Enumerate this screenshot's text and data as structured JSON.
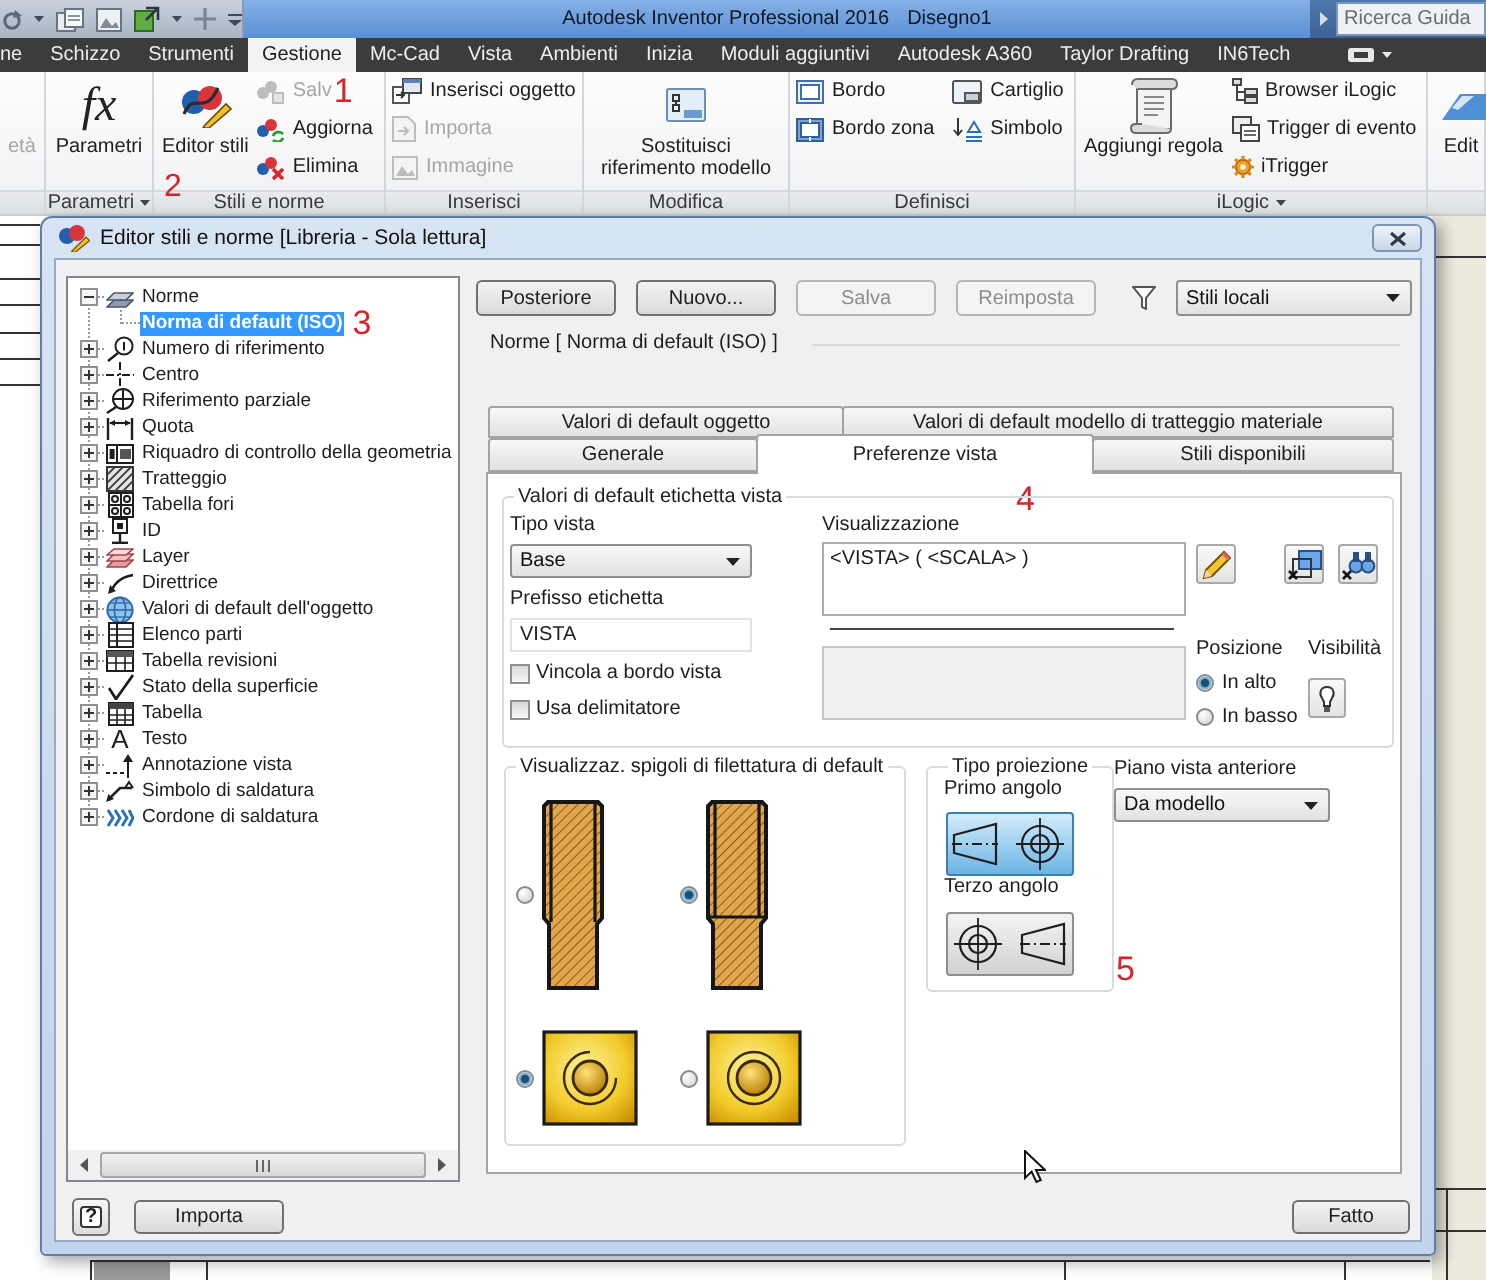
{
  "title_bar": {
    "title": "Autodesk Inventor Professional 2016",
    "document": "Disegno1",
    "search": {
      "placeholder": "Ricerca Guida"
    }
  },
  "ribbon_tabs": [
    {
      "label": "ne",
      "selected": false
    },
    {
      "label": "Schizzo",
      "selected": false
    },
    {
      "label": "Strumenti",
      "selected": false
    },
    {
      "label": "Gestione",
      "selected": true
    },
    {
      "label": "Mc-Cad",
      "selected": false
    },
    {
      "label": "Vista",
      "selected": false
    },
    {
      "label": "Ambienti",
      "selected": false
    },
    {
      "label": "Inizia",
      "selected": false
    },
    {
      "label": "Moduli aggiuntivi",
      "selected": false
    },
    {
      "label": "Autodesk A360",
      "selected": false
    },
    {
      "label": "Taylor Drafting",
      "selected": false
    },
    {
      "label": "IN6Tech",
      "selected": false
    }
  ],
  "ribbon_panels": [
    {
      "buttons": [
        {
          "kind": "large",
          "label": "età",
          "disabled": true
        }
      ]
    },
    {
      "title": "Parametri",
      "menu": true,
      "buttons": [
        {
          "kind": "large",
          "label": "Parametri",
          "glyph": "fx",
          "disabled": false
        }
      ]
    },
    {
      "title": "Stili e norme",
      "menu": false,
      "marker": "2",
      "buttons": [
        {
          "kind": "large",
          "label": "Editor stili",
          "disabled": false
        },
        {
          "kind": "small",
          "label": "Salv",
          "disabled": true,
          "marker": "1"
        },
        {
          "kind": "small",
          "label": "Aggiorna",
          "disabled": false
        },
        {
          "kind": "small",
          "label": "Elimina",
          "disabled": false
        }
      ]
    },
    {
      "title": "Inserisci",
      "menu": false,
      "buttons": [
        {
          "kind": "small",
          "label": "Inserisci oggetto",
          "disabled": false
        },
        {
          "kind": "small",
          "label": "Importa",
          "disabled": true
        },
        {
          "kind": "small",
          "label": "Immagine",
          "disabled": true
        }
      ]
    },
    {
      "title": "Modifica",
      "menu": false,
      "buttons": [
        {
          "kind": "large",
          "label": "Sostituisci riferimento modello",
          "disabled": false
        }
      ]
    },
    {
      "title": "Definisci",
      "menu": false,
      "buttons": [
        {
          "kind": "small",
          "label": "Bordo",
          "disabled": false
        },
        {
          "kind": "small",
          "label": "Bordo zona",
          "disabled": false
        },
        {
          "kind": "small",
          "label": "Cartiglio",
          "disabled": false
        },
        {
          "kind": "small",
          "label": "Simbolo",
          "disabled": false
        }
      ]
    },
    {
      "title": "iLogic",
      "menu": true,
      "buttons": [
        {
          "kind": "large",
          "label": "Aggiungi regola",
          "disabled": false
        },
        {
          "kind": "small",
          "label": "Browser iLogic",
          "disabled": false
        },
        {
          "kind": "small",
          "label": "Trigger di evento",
          "disabled": false
        },
        {
          "kind": "small",
          "label": "iTrigger",
          "disabled": false
        }
      ]
    },
    {
      "buttons": [
        {
          "kind": "large",
          "label": "Edit",
          "disabled": false
        }
      ]
    }
  ],
  "dialog": {
    "title": "Editor stili e norme [Libreria - Sola lettura]",
    "tree": [
      {
        "label": "Norme",
        "expanded": true,
        "selected": false,
        "children": [
          {
            "label": "Norma di default (ISO)",
            "selected": true,
            "marker": "3"
          }
        ]
      },
      {
        "label": "Numero di riferimento",
        "expanded": false,
        "selected": false
      },
      {
        "label": "Centro",
        "expanded": false,
        "selected": false
      },
      {
        "label": "Riferimento parziale",
        "expanded": false,
        "selected": false
      },
      {
        "label": "Quota",
        "expanded": false,
        "selected": false
      },
      {
        "label": "Riquadro di controllo della geometria",
        "expanded": false,
        "selected": false
      },
      {
        "label": "Tratteggio",
        "expanded": false,
        "selected": false
      },
      {
        "label": "Tabella fori",
        "expanded": false,
        "selected": false
      },
      {
        "label": "ID",
        "expanded": false,
        "selected": false
      },
      {
        "label": "Layer",
        "expanded": false,
        "selected": false
      },
      {
        "label": "Direttrice",
        "expanded": false,
        "selected": false
      },
      {
        "label": "Valori di default dell'oggetto",
        "expanded": false,
        "selected": false
      },
      {
        "label": "Elenco parti",
        "expanded": false,
        "selected": false
      },
      {
        "label": "Tabella revisioni",
        "expanded": false,
        "selected": false
      },
      {
        "label": "Stato della superficie",
        "expanded": false,
        "selected": false
      },
      {
        "label": "Tabella",
        "expanded": false,
        "selected": false
      },
      {
        "label": "Testo",
        "expanded": false,
        "selected": false,
        "glyph": "A"
      },
      {
        "label": "Annotazione vista",
        "expanded": false,
        "selected": false
      },
      {
        "label": "Simbolo di saldatura",
        "expanded": false,
        "selected": false
      },
      {
        "label": "Cordone di saldatura",
        "expanded": false,
        "selected": false
      }
    ],
    "toolbar": [
      {
        "label": "Posteriore",
        "disabled": false
      },
      {
        "label": "Nuovo...",
        "disabled": false
      },
      {
        "label": "Salva",
        "disabled": true
      },
      {
        "label": "Reimposta",
        "disabled": true
      }
    ],
    "filter": {
      "value": "Stili locali"
    },
    "heading": "Norme [ Norma di default (ISO) ]",
    "tab_rows": [
      {
        "tabs": [
          {
            "label": "Valori di default oggetto",
            "selected": false
          },
          {
            "label": "Valori di default modello di tratteggio materiale",
            "selected": false
          }
        ]
      },
      {
        "tabs": [
          {
            "label": "Generale",
            "selected": false
          },
          {
            "label": "Preferenze vista",
            "selected": true
          },
          {
            "label": "Stili disponibili",
            "selected": false
          }
        ]
      }
    ],
    "tab_marker": "4",
    "view_label": {
      "title": "Valori di default etichetta vista",
      "view_type": {
        "label": "Tipo vista",
        "value": "Base"
      },
      "prefix": {
        "label": "Prefisso etichetta",
        "value": "VISTA"
      },
      "options": [
        {
          "label": "Vincola a bordo vista",
          "checked": false
        },
        {
          "label": "Usa delimitatore",
          "checked": false
        }
      ],
      "display": {
        "label": "Visualizzazione",
        "value": "<VISTA> ( <SCALA> )"
      },
      "position": {
        "label": "Posizione",
        "choices": [
          {
            "label": "In alto",
            "selected": true
          },
          {
            "label": "In basso",
            "selected": false
          }
        ]
      },
      "visibility": {
        "label": "Visibilità"
      }
    },
    "thread_display": {
      "title": "Visualizzaz. spigoli di filettatura di default",
      "side_views": [
        {
          "kind": "full",
          "selected": false
        },
        {
          "kind": "partial",
          "selected": true
        }
      ],
      "end_views": [
        {
          "kind": "arc",
          "selected": true
        },
        {
          "kind": "circle",
          "selected": false
        }
      ]
    },
    "projection": {
      "title": "Tipo proiezione",
      "choices": [
        {
          "label": "Primo angolo",
          "kind": "first",
          "selected": true
        },
        {
          "label": "Terzo angolo",
          "kind": "third",
          "selected": false,
          "marker": "5"
        }
      ]
    },
    "front_view": {
      "label": "Piano vista anteriore",
      "value": "Da modello"
    },
    "footer": {
      "help": "?",
      "buttons": [
        {
          "label": "Importa"
        },
        {
          "label": "Fatto"
        }
      ]
    }
  }
}
